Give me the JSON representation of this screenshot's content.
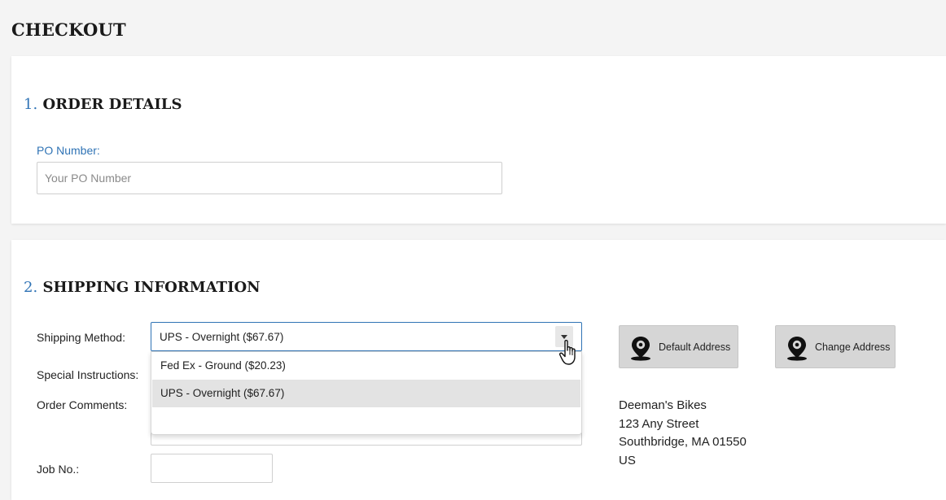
{
  "page": {
    "title": "CHECKOUT"
  },
  "order_details": {
    "number": "1.",
    "title": "ORDER DETAILS",
    "po_label": "PO Number:",
    "po_placeholder": "Your PO Number"
  },
  "shipping": {
    "number": "2.",
    "title": "SHIPPING INFORMATION",
    "method_label": "Shipping Method:",
    "method_selected": "UPS - Overnight ($67.67)",
    "method_options": [
      "Fed Ex - Ground ($20.23)",
      "UPS - Overnight ($67.67)"
    ],
    "special_label": "Special Instructions:",
    "comments_label": "Order Comments:",
    "job_label": "Job No.:",
    "default_address_button": "Default Address",
    "change_address_button": "Change Address",
    "address": {
      "name": "Deeman's Bikes",
      "street": "123 Any Street",
      "city_line": "Southbridge, MA 01550",
      "country": "US"
    }
  },
  "icons": {
    "address_icon": "map-pin-icon",
    "dropdown_icon": "caret-down-icon",
    "cursor_icon": "hand-pointer-icon"
  },
  "colors": {
    "accent": "#2f73b5",
    "background": "#f4f4f4",
    "button": "#d6d6d6",
    "option_highlight": "#e3e3e3"
  }
}
